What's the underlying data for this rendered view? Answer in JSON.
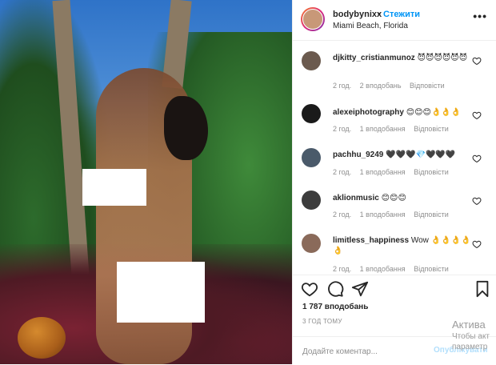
{
  "header": {
    "username": "bodybynixx",
    "dot": "•",
    "follow_label": "Стежити",
    "location": "Miami Beach, Florida",
    "more_glyph": "•••"
  },
  "comments": [
    {
      "username": "djkitty_cristianmunoz",
      "text": "😈😈😈😈😈😈",
      "age": "2 год.",
      "likes": "2 вподобань",
      "reply": "Відповісти",
      "avatar_color": "#6b5a4e"
    },
    {
      "username": "alexeiphotography",
      "text": "😊😊😊👌👌👌",
      "age": "2 год.",
      "likes": "1 вподобання",
      "reply": "Відповісти",
      "avatar_color": "#1a1a1a"
    },
    {
      "username": "pachhu_9249",
      "text": "🖤🖤🖤💎🖤🖤🖤",
      "age": "2 год.",
      "likes": "1 вподобання",
      "reply": "Відповісти",
      "avatar_color": "#4a5a6a"
    },
    {
      "username": "aklionmusic",
      "text": "😊😊😊",
      "age": "2 год.",
      "likes": "1 вподобання",
      "reply": "Відповісти",
      "avatar_color": "#3c3c3c"
    },
    {
      "username": "limitless_happiness",
      "text": "Wow 👌👌👌👌👌",
      "age": "2 год.",
      "likes": "1 вподобання",
      "reply": "Відповісти",
      "avatar_color": "#8a6a5a"
    }
  ],
  "post": {
    "likes": "1 787 вподобань",
    "time_ago": "3 ГОД ТОМУ"
  },
  "add_comment": {
    "placeholder": "Додайте коментар...",
    "publish_label": "Опублікувати"
  },
  "watermark": {
    "line1": "Актива",
    "line2": "Чтобы акт",
    "line3": "параметр"
  },
  "colors": {
    "accent": "#0095f6",
    "publish_disabled": "#b2dffc",
    "muted": "#8e8e8e"
  }
}
